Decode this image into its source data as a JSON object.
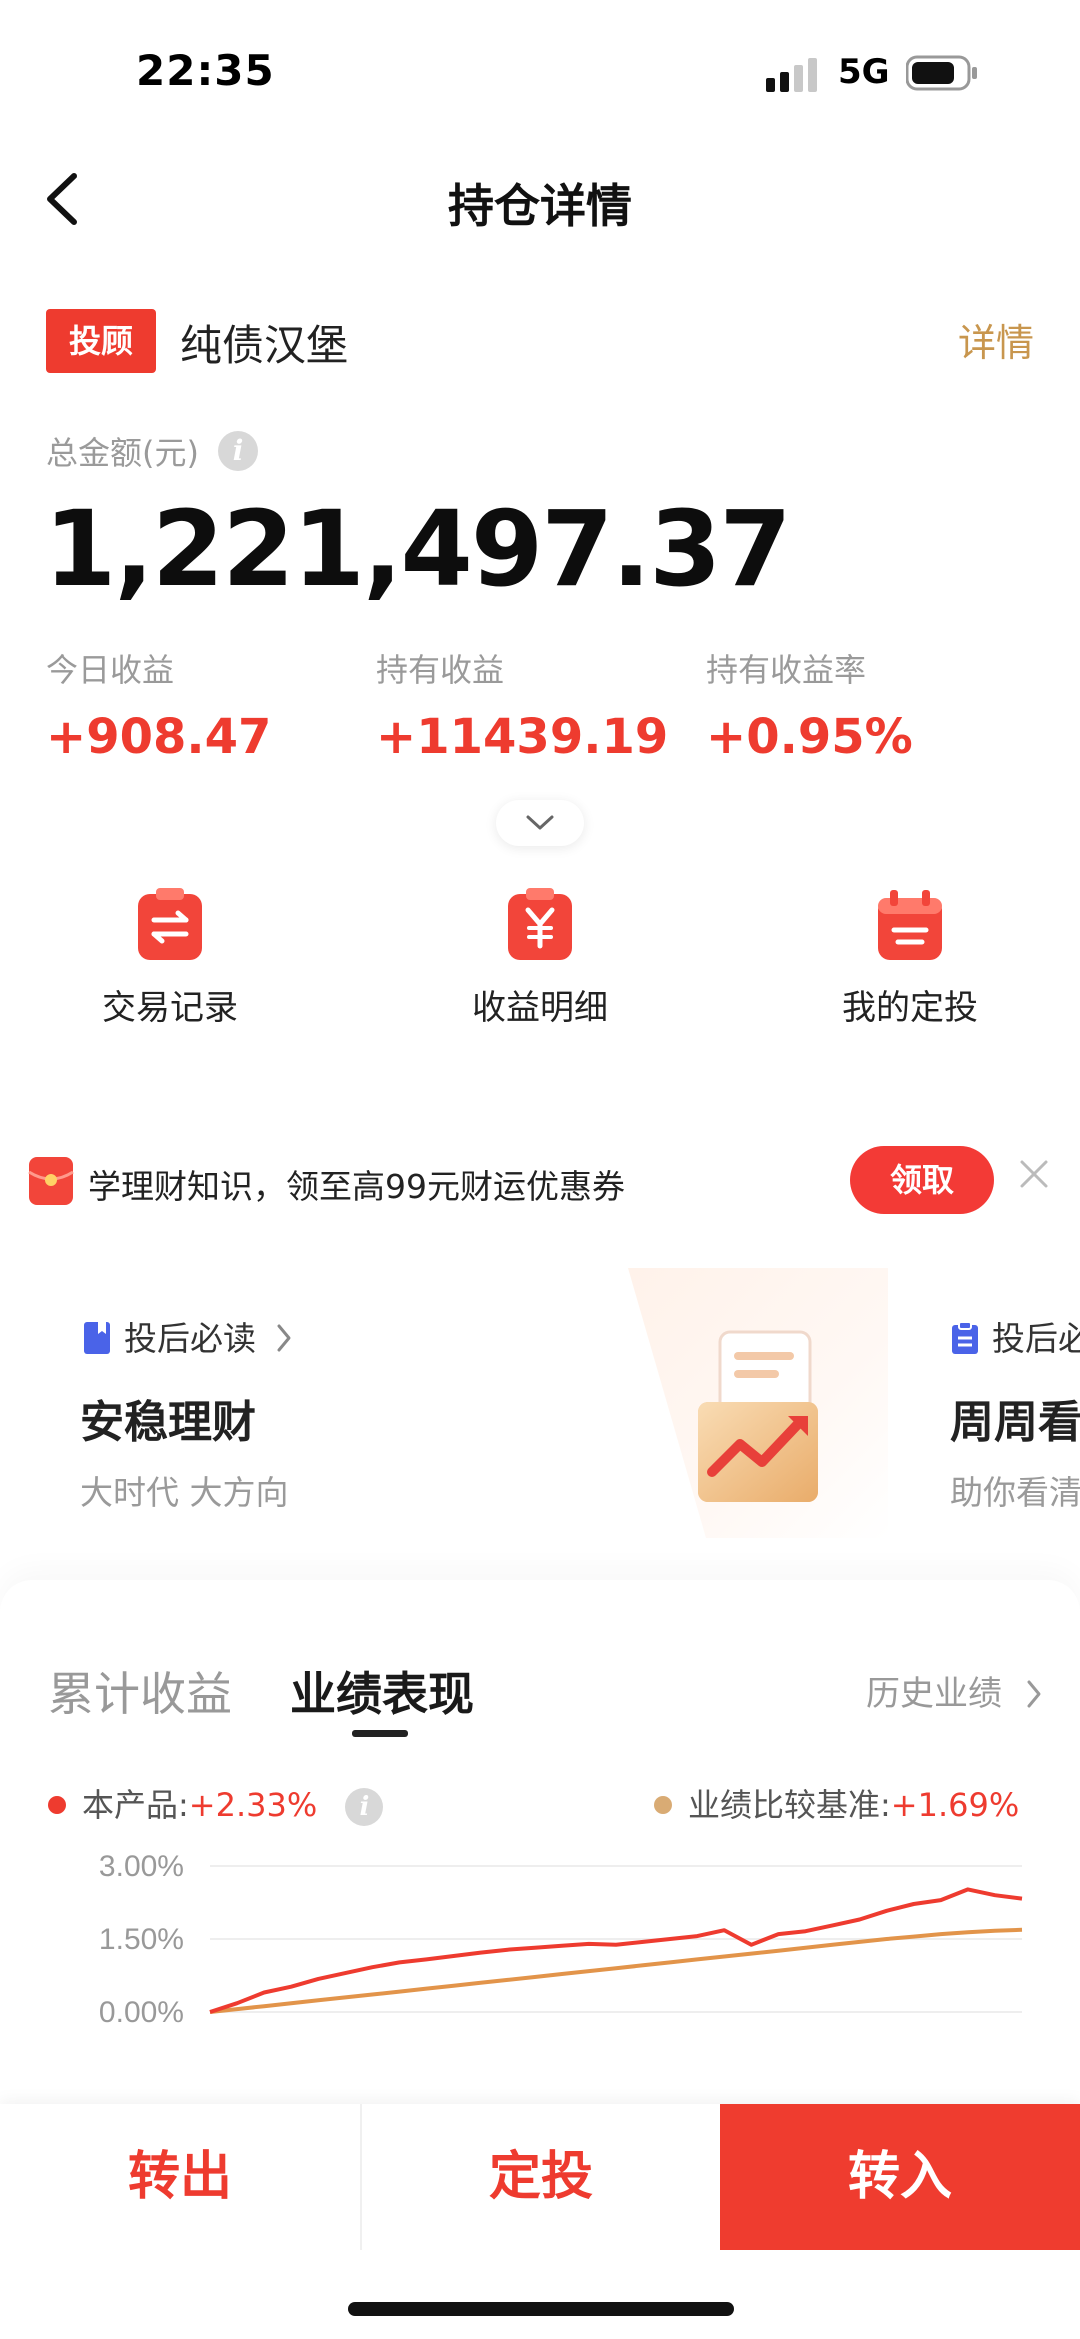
{
  "status_bar": {
    "time": "22:35",
    "network": "5G"
  },
  "nav": {
    "title": "持仓详情"
  },
  "product": {
    "badge": "投顾",
    "name": "纯债汉堡",
    "detail_link": "详情"
  },
  "summary": {
    "total_label": "总金额(元)",
    "total_amount": "1,221,497.37",
    "stats": [
      {
        "label": "今日收益",
        "value": "+908.47"
      },
      {
        "label": "持有收益",
        "value": "+11439.19"
      },
      {
        "label": "持有收益率",
        "value": "+0.95%"
      }
    ]
  },
  "actions": [
    {
      "label": "交易记录",
      "icon": "transfer-record-icon"
    },
    {
      "label": "收益明细",
      "icon": "income-detail-icon"
    },
    {
      "label": "我的定投",
      "icon": "calendar-icon"
    }
  ],
  "promo": {
    "text": "学理财知识，领至高99元财运优惠券",
    "button": "领取"
  },
  "cards": [
    {
      "tag": "投后必读",
      "title": "安稳理财",
      "subtitle": "大时代 大方向"
    },
    {
      "tag": "投后必读",
      "title": "周周看",
      "subtitle": "助你看清"
    }
  ],
  "performance": {
    "tabs": [
      "累计收益",
      "业绩表现"
    ],
    "active_tab": "业绩表现",
    "history_link": "历史业绩",
    "legend": [
      {
        "label": "本产品:",
        "value": "+2.33%",
        "color": "#ee3b2f"
      },
      {
        "label": "业绩比较基准:",
        "value": "+1.69%",
        "color": "#d9ab74"
      }
    ]
  },
  "chart_data": {
    "type": "line",
    "y_ticks": [
      "3.00%",
      "1.50%",
      "0.00%"
    ],
    "ylim": [
      0,
      3.0
    ],
    "series": [
      {
        "name": "本产品",
        "color": "#ee3b2f",
        "values": [
          0.0,
          0.18,
          0.4,
          0.52,
          0.68,
          0.8,
          0.92,
          1.02,
          1.08,
          1.15,
          1.22,
          1.28,
          1.32,
          1.36,
          1.4,
          1.38,
          1.44,
          1.5,
          1.56,
          1.68,
          1.38,
          1.6,
          1.66,
          1.78,
          1.9,
          2.08,
          2.22,
          2.3,
          2.52,
          2.4,
          2.33
        ]
      },
      {
        "name": "业绩比较基准",
        "color": "#e2944a",
        "values": [
          0.0,
          0.06,
          0.12,
          0.18,
          0.24,
          0.3,
          0.36,
          0.42,
          0.48,
          0.54,
          0.6,
          0.66,
          0.72,
          0.78,
          0.84,
          0.9,
          0.96,
          1.02,
          1.08,
          1.14,
          1.2,
          1.26,
          1.32,
          1.38,
          1.44,
          1.5,
          1.55,
          1.6,
          1.64,
          1.67,
          1.69
        ]
      }
    ]
  },
  "bottom_bar": {
    "sell": "转出",
    "auto_invest": "定投",
    "buy": "转入"
  }
}
